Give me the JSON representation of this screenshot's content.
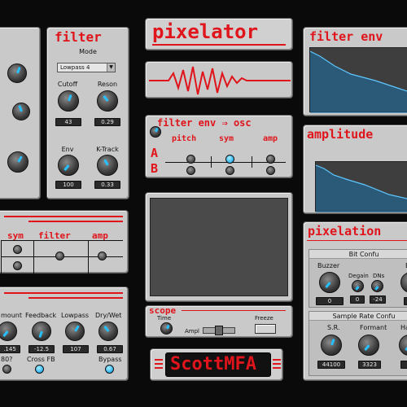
{
  "app": {
    "title": "pixelator",
    "brand": "ScottMFA",
    "accent_color": "#e0141b",
    "led_color": "#3bbcf5",
    "knob_indicator_color": "#26c0ff"
  },
  "filter": {
    "title": "filter",
    "mode_label": "Mode",
    "mode_value": "Lowpass 4",
    "cutoff_label": "Cutoff",
    "cutoff_value": "43",
    "reson_label": "Reson",
    "reson_value": "0.29",
    "env_label": "Env",
    "env_value": "100",
    "ktrack_label": "K-Track",
    "ktrack_value": "0.33"
  },
  "filter_env": {
    "title": "filter env"
  },
  "amp_env": {
    "title": "amplitude"
  },
  "filter_env_osc": {
    "title": "filter env",
    "arrow": "⇒",
    "title2": "osc",
    "col_pitch": "pitch",
    "col_sym": "sym",
    "col_amp": "amp",
    "row_a": "A",
    "row_b": "B"
  },
  "matrix": {
    "col_sym": "sym",
    "col_filter": "filter",
    "col_amp": "amp"
  },
  "effects": {
    "amount_label": "mount",
    "amount_value": ".145",
    "feedback_label": "Feedback",
    "feedback_value": "-12.5",
    "lowpass_label": "Lowpass",
    "lowpass_value": "107",
    "drywet_label": "Dry/Wet",
    "drywet_value": "0.67",
    "toggle80_label": "80?",
    "crossfb_label": "Cross FB",
    "bypass_label": "Bypass"
  },
  "scope": {
    "title": "scope",
    "time_label": "Time",
    "ampl_label": "Ampl",
    "freeze_label": "Freeze"
  },
  "pixelation": {
    "title": "pixelation",
    "bitconf_title": "Bit Confu",
    "buzzer_label": "Buzzer",
    "buzzer_value": "0",
    "degain_label": "Degain",
    "degain_value": "0",
    "dns_label": "DNs",
    "dns_value": "-24",
    "bi_label": "Bi",
    "bi_value": "4.",
    "srconf_title": "Sample Rate Confu",
    "sr_label": "S.R.",
    "sr_value": "44100",
    "formant_label": "Formant",
    "formant_value": "3323",
    "har_label": "Har",
    "har_value": "0."
  }
}
